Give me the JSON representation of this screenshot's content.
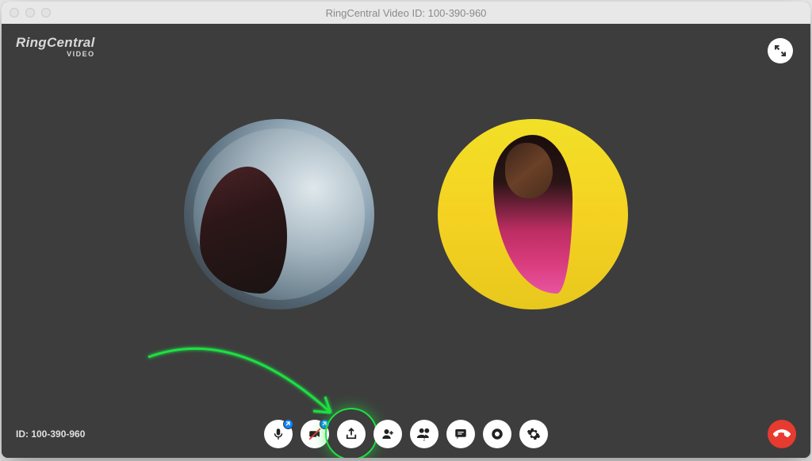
{
  "window": {
    "title": "RingCentral Video ID: 100-390-960"
  },
  "branding": {
    "name": "RingCentral",
    "sub": "VIDEO"
  },
  "meeting": {
    "id_label": "ID: 100-390-960",
    "participant_count_badge": "2"
  },
  "controls": {
    "mute": "mute-icon",
    "video": "video-off-icon",
    "share": "share-icon",
    "invite": "add-participant-icon",
    "participants": "participants-icon",
    "chat": "chat-icon",
    "record": "record-icon",
    "settings": "gear-icon"
  },
  "colors": {
    "bg": "#3d3d3d",
    "hangup": "#e63b2e",
    "highlight": "#1fe042",
    "badge": "#0b84ff"
  }
}
